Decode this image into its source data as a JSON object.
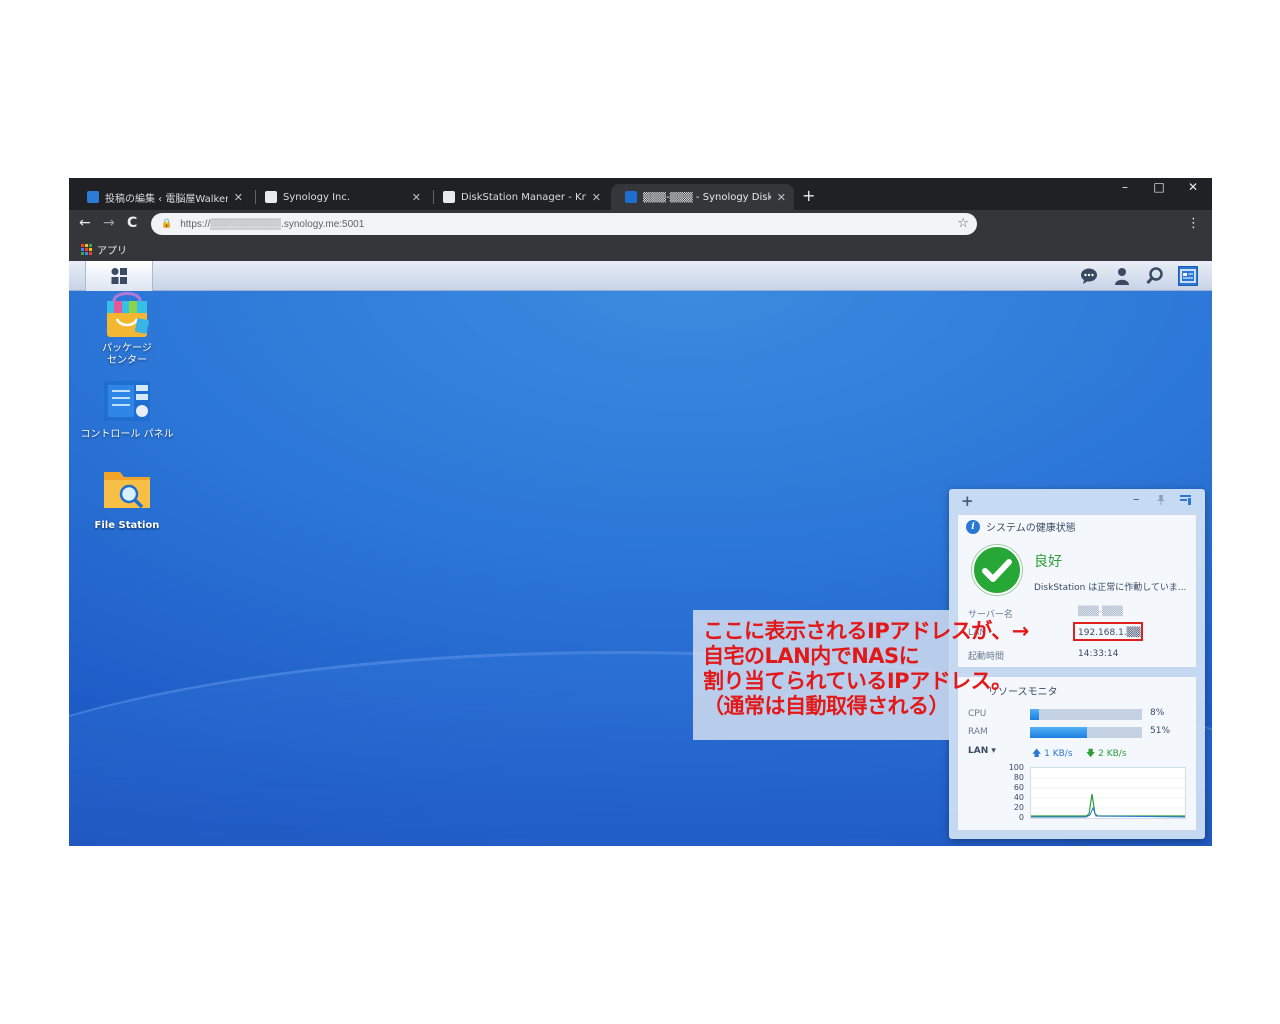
{
  "browser": {
    "tabs": [
      {
        "title": "投稿の編集 ‹ 電脳屋Walker — W",
        "active": false,
        "favicon_color": "#2c7bd6"
      },
      {
        "title": "Synology Inc.",
        "active": false,
        "favicon_color": "#e8eaed"
      },
      {
        "title": "DiskStation Manager - Knowledg",
        "active": false,
        "favicon_color": "#e8eaed"
      },
      {
        "title": "▒▒▒-▒▒▒ - Synology DiskStation",
        "active": true,
        "favicon_color": "#1f6fd0"
      }
    ],
    "new_tab_label": "+",
    "window_controls": {
      "minimize": "–",
      "maximize": "□",
      "close": "✕"
    },
    "nav": {
      "back": "←",
      "forward": "→",
      "reload": "C"
    },
    "url": "https://▒▒▒▒▒▒▒▒▒▒.synology.me:5001",
    "star": "☆",
    "menu": "⋮",
    "bookmarks": [
      {
        "label": "アプリ",
        "icon": "apps-grid-icon"
      }
    ]
  },
  "dsm": {
    "taskbar_icons": [
      "chat-icon",
      "user-icon",
      "search-icon",
      "widgets-icon"
    ],
    "desktop_icons": [
      {
        "label": "パッケージ\nセンター",
        "icon": "package-center-icon"
      },
      {
        "label": "コントロール パネル",
        "icon": "control-panel-icon"
      },
      {
        "label": "File Station",
        "icon": "file-station-icon"
      }
    ],
    "widget": {
      "add": "+",
      "minimize": "–",
      "pin": "📌",
      "toggle": "▭",
      "health": {
        "title": "システムの健康状態",
        "status": "良好",
        "description": "DiskStation は正常に作動していま...",
        "rows": [
          {
            "label": "サーバー名",
            "value": "▒▒▒-▒▒▒"
          },
          {
            "label": "LAN",
            "value": "192.168.1.▒▒"
          },
          {
            "label": "起動時間",
            "value": "14:33:14"
          }
        ]
      },
      "resource": {
        "title": "リソースモニタ",
        "cpu_label": "CPU",
        "cpu_value": 0.08,
        "cpu_text": "8%",
        "ram_label": "RAM",
        "ram_value": 0.51,
        "ram_text": "51%",
        "lan_label": "LAN ▾",
        "upload": "1 KB/s",
        "download": "2 KB/s",
        "yticks": [
          "100",
          "80",
          "60",
          "40",
          "20",
          "0"
        ]
      }
    }
  },
  "annotation": {
    "text": "ここに表示されるIPアドレスが、→\n自宅のLAN内でNASに\n割り当てられているIPアドレス。\n（通常は自動取得される）",
    "color": "#e31818"
  }
}
